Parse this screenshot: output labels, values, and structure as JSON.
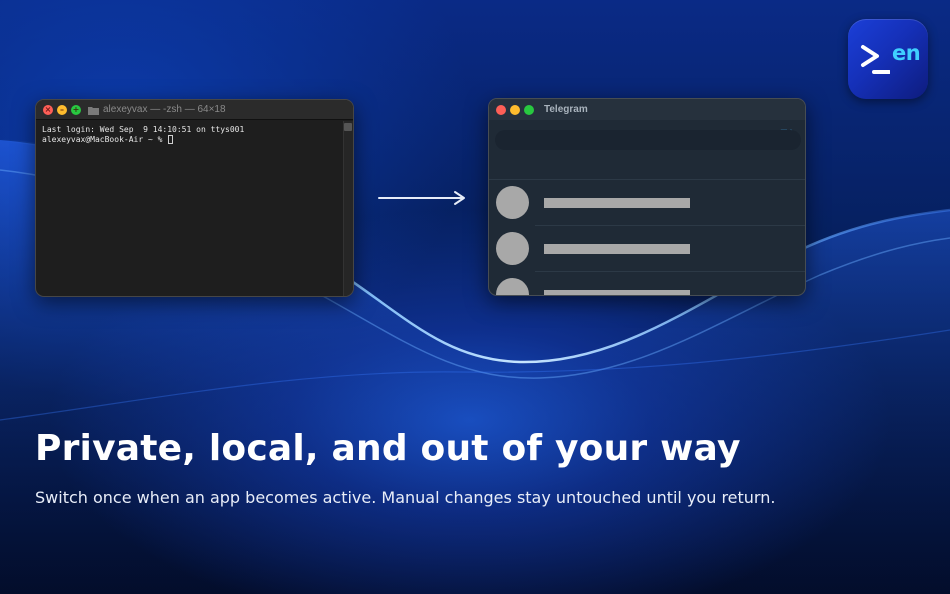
{
  "app_icon": {
    "label": "en",
    "icon": "terminal-prompt-icon",
    "colors": {
      "background": "#1b3fd8",
      "text": "#3fd0ff"
    }
  },
  "terminal": {
    "title": "alexeyvax — -zsh — 64×18",
    "lines": [
      "Last login: Wed Sep  9 14:10:51 on ttys001",
      "alexeyvax@MacBook-Air ~ % "
    ]
  },
  "telegram": {
    "title": "Telegram",
    "chats": [
      {
        "avatar": "placeholder",
        "text": "placeholder"
      },
      {
        "avatar": "placeholder",
        "text": "placeholder"
      },
      {
        "avatar": "placeholder",
        "text": "placeholder"
      }
    ]
  },
  "headline": "Private, local, and out of your way",
  "subline": "Switch once when an app becomes active. Manual changes stay untouched until you return.",
  "colors": {
    "background": "#06205f",
    "traffic_red": "#fe5f57",
    "traffic_yellow": "#febc2e",
    "traffic_green": "#28c840",
    "telegram_accent": "#3a9ad9"
  }
}
